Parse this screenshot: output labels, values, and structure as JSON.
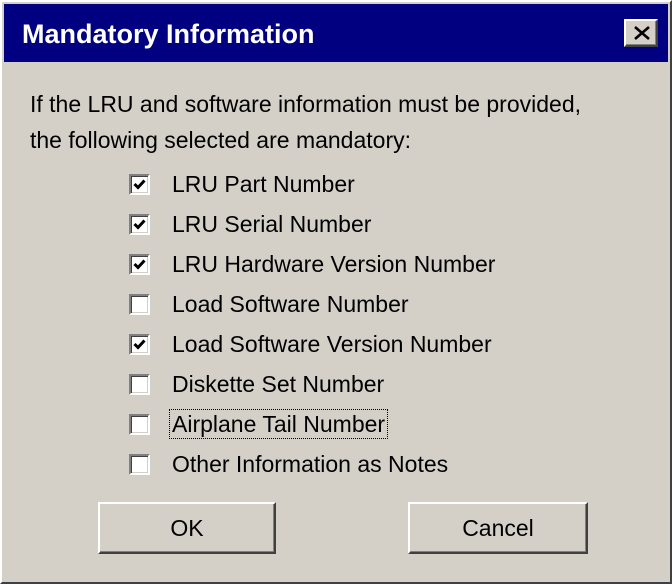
{
  "window": {
    "title": "Mandatory Information",
    "close_icon": "close-icon"
  },
  "description": {
    "line1": "If the LRU and software information must be provided,",
    "line2": "the following selected are mandatory:"
  },
  "options": [
    {
      "label": "LRU Part Number",
      "checked": true,
      "focused": false
    },
    {
      "label": "LRU Serial Number",
      "checked": true,
      "focused": false
    },
    {
      "label": "LRU Hardware Version Number",
      "checked": true,
      "focused": false
    },
    {
      "label": "Load Software Number",
      "checked": false,
      "focused": false
    },
    {
      "label": "Load Software Version Number",
      "checked": true,
      "focused": false
    },
    {
      "label": "Diskette Set Number",
      "checked": false,
      "focused": false
    },
    {
      "label": "Airplane Tail Number",
      "checked": false,
      "focused": true
    },
    {
      "label": "Other Information as Notes",
      "checked": false,
      "focused": false
    }
  ],
  "buttons": {
    "ok": "OK",
    "cancel": "Cancel"
  },
  "colors": {
    "titlebar": "#000080",
    "face": "#d4d0c8",
    "title_text": "#ffffff"
  }
}
